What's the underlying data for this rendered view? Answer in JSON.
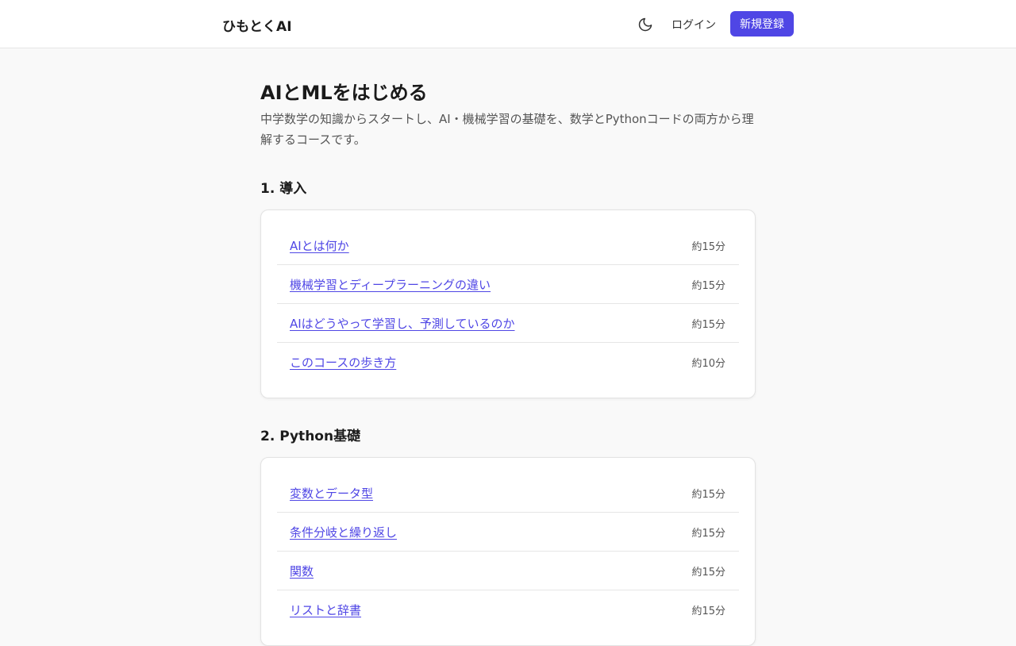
{
  "header": {
    "logo": "ひもとくAI",
    "theme_icon": "moon-icon",
    "login_label": "ログイン",
    "signup_label": "新規登録",
    "accent_color": "#4f46e5"
  },
  "course": {
    "title": "AIとMLをはじめる",
    "description": "中学数学の知識からスタートし、AI・機械学習の基礎を、数学とPythonコードの両方から理解するコースです。"
  },
  "sections": [
    {
      "title": "1. 導入",
      "lessons": [
        {
          "title": "AIとは何か",
          "duration": "約15分"
        },
        {
          "title": "機械学習とディープラーニングの違い",
          "duration": "約15分"
        },
        {
          "title": "AIはどうやって学習し、予測しているのか",
          "duration": "約15分"
        },
        {
          "title": "このコースの歩き方",
          "duration": "約10分"
        }
      ]
    },
    {
      "title": "2. Python基礎",
      "lessons": [
        {
          "title": "変数とデータ型",
          "duration": "約15分"
        },
        {
          "title": "条件分岐と繰り返し",
          "duration": "約15分"
        },
        {
          "title": "関数",
          "duration": "約15分"
        },
        {
          "title": "リストと辞書",
          "duration": "約15分"
        }
      ]
    }
  ]
}
